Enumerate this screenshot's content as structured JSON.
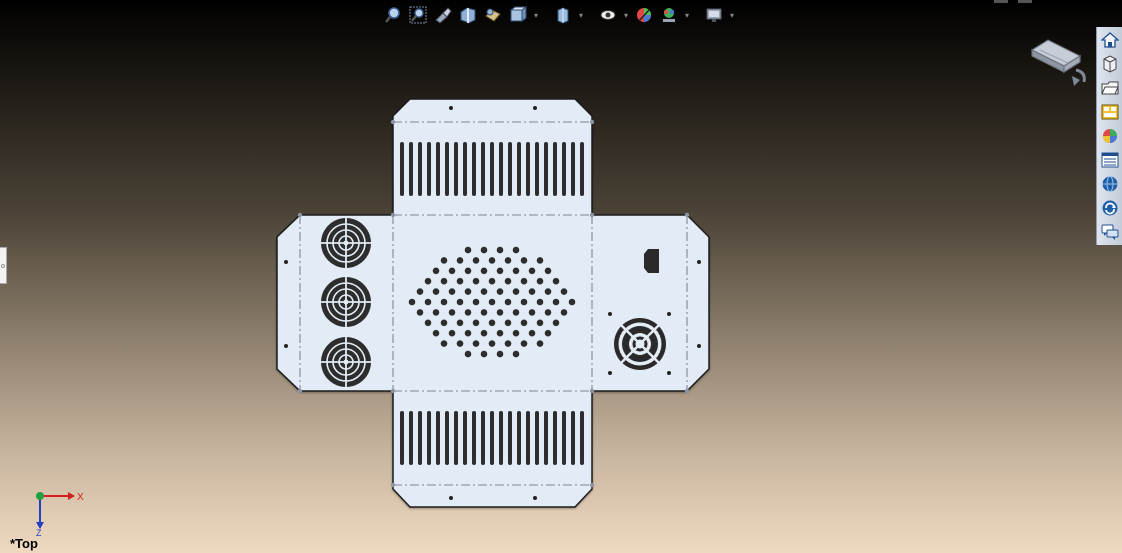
{
  "viewport": {
    "view_label": "*Top",
    "background_colors": [
      "#000000",
      "#8a7c6a",
      "#efd9c0"
    ],
    "part_fill": "#e3ecf6",
    "part_edge": "#1b1b1b",
    "hole_color": "#2d2d2d"
  },
  "heads_up_toolbar": [
    {
      "icon": "zoom-to-fit-icon",
      "has_dropdown": false
    },
    {
      "icon": "zoom-to-area-icon",
      "has_dropdown": false
    },
    {
      "icon": "previous-view-icon",
      "has_dropdown": false
    },
    {
      "icon": "section-view-icon",
      "has_dropdown": false
    },
    {
      "icon": "dynamic-annotation-views-icon",
      "has_dropdown": false
    },
    {
      "icon": "view-orientation-icon",
      "has_dropdown": true
    },
    {
      "icon": "display-style-icon",
      "has_dropdown": true
    },
    {
      "icon": "hide-show-items-icon",
      "has_dropdown": true
    },
    {
      "icon": "edit-appearance-icon",
      "has_dropdown": false
    },
    {
      "icon": "apply-scene-icon",
      "has_dropdown": true
    },
    {
      "icon": "view-settings-icon",
      "has_dropdown": true
    }
  ],
  "task_pane_tabs": [
    {
      "icon": "home-icon"
    },
    {
      "icon": "design-library-icon"
    },
    {
      "icon": "file-explorer-icon"
    },
    {
      "icon": "view-palette-icon"
    },
    {
      "icon": "appearances-scenes-icon"
    },
    {
      "icon": "custom-properties-icon"
    },
    {
      "icon": "solidworks-resources-icon"
    },
    {
      "icon": "refresh-icon"
    },
    {
      "icon": "forum-icon"
    }
  ],
  "triad": {
    "x_label": "X",
    "y_label": "Z"
  }
}
